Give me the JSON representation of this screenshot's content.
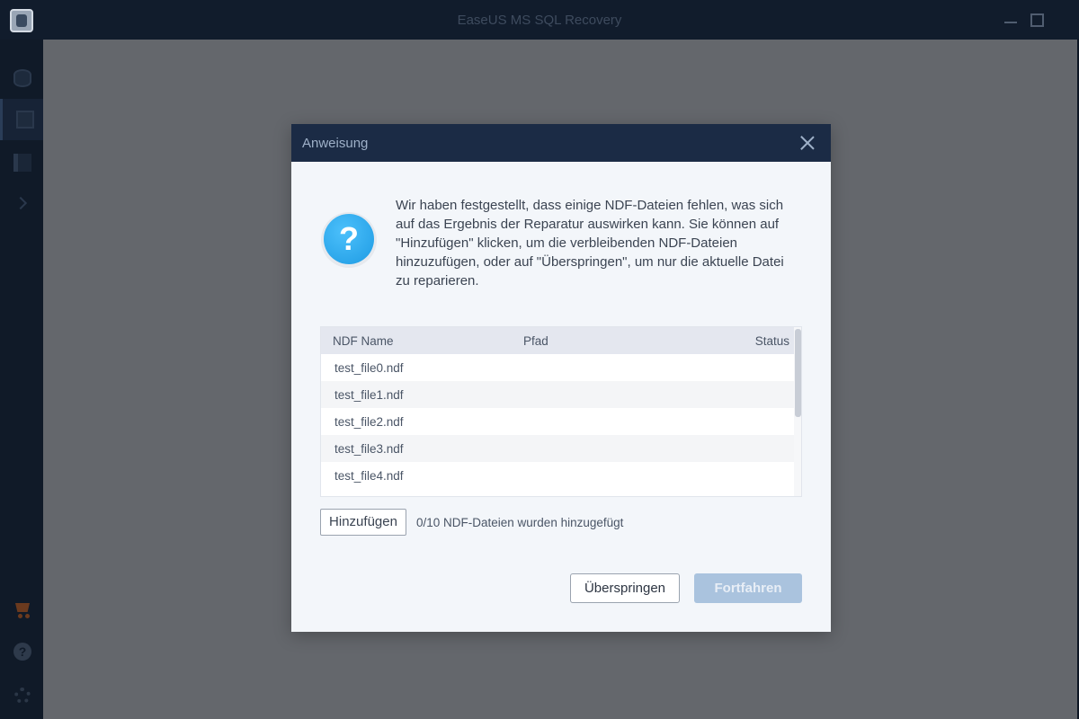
{
  "window": {
    "title": "EaseUS MS SQL Recovery"
  },
  "dialog": {
    "title": "Anweisung",
    "message": "Wir haben festgestellt, dass einige NDF-Dateien fehlen, was sich auf das Ergebnis der Reparatur auswirken kann. Sie können auf \"Hinzufügen\" klicken, um die verbleibenden NDF-Dateien hinzuzufügen, oder auf \"Überspringen\", um nur die aktuelle Datei zu reparieren.",
    "table": {
      "headers": [
        "NDF Name",
        "Pfad",
        "Status"
      ],
      "rows": [
        {
          "name": "test_file0.ndf",
          "path": "",
          "status": ""
        },
        {
          "name": "test_file1.ndf",
          "path": "",
          "status": ""
        },
        {
          "name": "test_file2.ndf",
          "path": "",
          "status": ""
        },
        {
          "name": "test_file3.ndf",
          "path": "",
          "status": ""
        },
        {
          "name": "test_file4.ndf",
          "path": "",
          "status": ""
        }
      ]
    },
    "add_button": "Hinzufügen",
    "add_status": "0/10 NDF-Dateien wurden hinzugefügt",
    "skip_button": "Überspringen",
    "continue_button": "Fortfahren"
  },
  "icons": {
    "app_logo": "database-logo-icon",
    "dialog_icon": "question-icon",
    "close": "close-icon",
    "cart": "cart-icon",
    "help": "help-icon",
    "settings": "gear-icon"
  },
  "colors": {
    "dialog_header": "#1b2b45",
    "primary_button_disabled": "#aac3de",
    "question_icon": "#2aa8f0",
    "cart_icon": "#6b3a1e"
  }
}
